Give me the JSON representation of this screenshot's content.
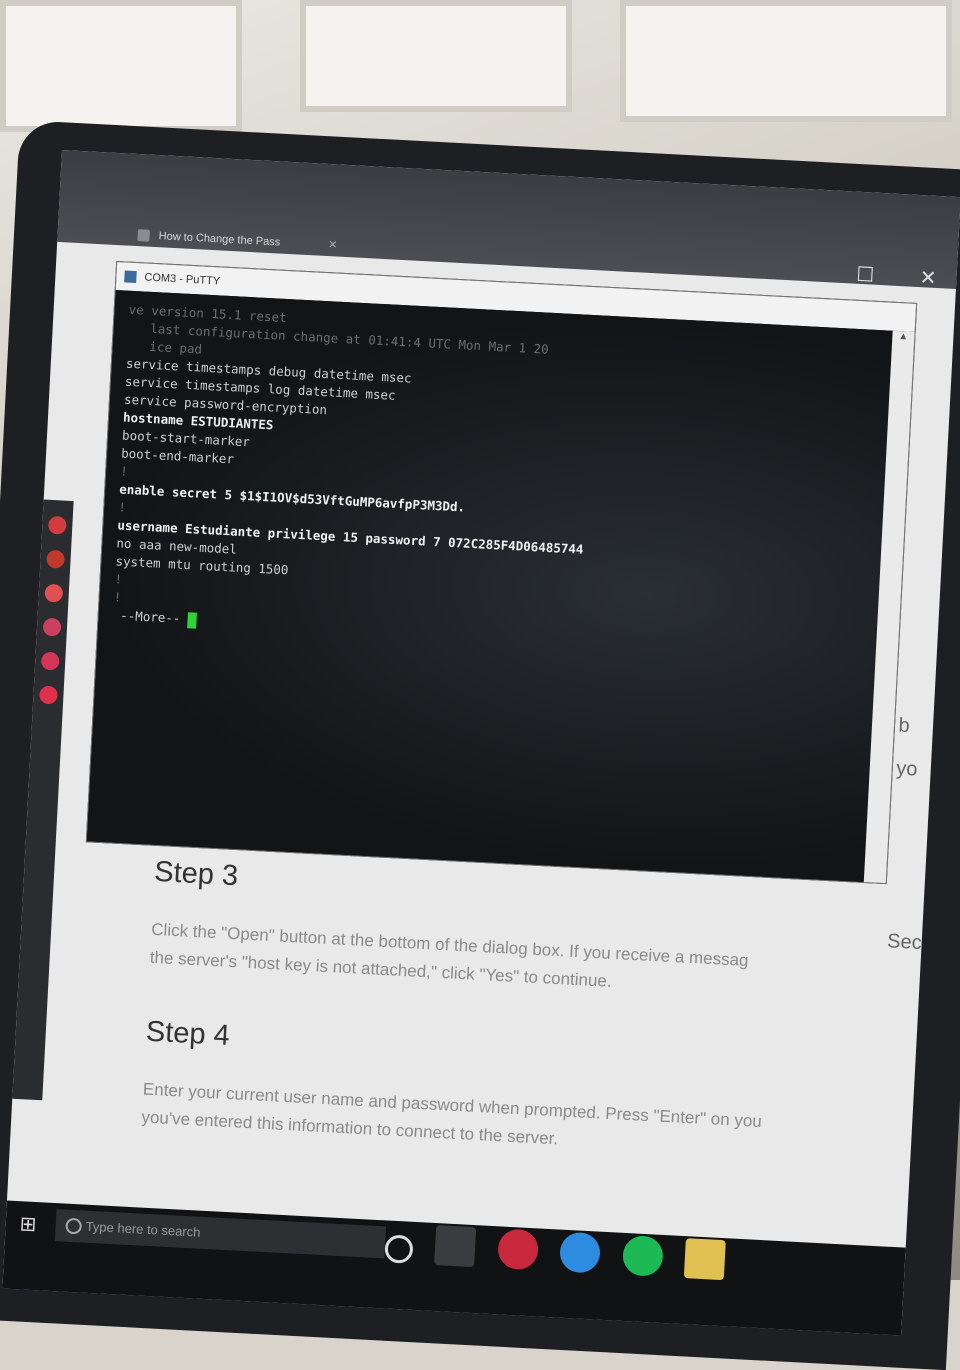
{
  "browser": {
    "tab_title": "How to Change the Pass",
    "tab_close": "✕",
    "maximize": "☐",
    "close": "✕"
  },
  "putty": {
    "title": "COM3 - PuTTY",
    "lines": [
      {
        "text": "ve version 15.1 reset",
        "style": "dim"
      },
      {
        "text": "   last configuration change at 01:41:4 UTC Mon Mar 1 20",
        "style": "dim"
      },
      {
        "text": "",
        "style": "dim"
      },
      {
        "text": "",
        "style": "dim"
      },
      {
        "text": "   ice pad",
        "style": "dim"
      },
      {
        "text": "service timestamps debug datetime msec",
        "style": "normal"
      },
      {
        "text": "service timestamps log datetime msec",
        "style": "normal"
      },
      {
        "text": "service password-encryption",
        "style": "normal"
      },
      {
        "text": "",
        "style": "dim"
      },
      {
        "text": "hostname ESTUDIANTES",
        "style": "bold"
      },
      {
        "text": "",
        "style": "dim"
      },
      {
        "text": "boot-start-marker",
        "style": "normal"
      },
      {
        "text": "boot-end-marker",
        "style": "normal"
      },
      {
        "text": "!",
        "style": "dim"
      },
      {
        "text": "",
        "style": "dim"
      },
      {
        "text": "enable secret 5 $1$I1OV$d53VftGuMP6avfpP3M3Dd.",
        "style": "bold"
      },
      {
        "text": "!",
        "style": "dim"
      },
      {
        "text": "username Estudiante privilege 15 password 7 072C285F4D06485744",
        "style": "bold"
      },
      {
        "text": "no aaa new-model",
        "style": "normal"
      },
      {
        "text": "system mtu routing 1500",
        "style": "normal"
      },
      {
        "text": "!",
        "style": "dim"
      },
      {
        "text": "!",
        "style": "dim"
      },
      {
        "text": "",
        "style": "dim"
      }
    ],
    "more_prompt": " --More-- "
  },
  "page": {
    "step3_title": "Step 3",
    "step3_text_1": "Click the \"Open\" button at the bottom of the dialog box. If you receive a messag",
    "step3_text_2": "the server's \"host key is not attached,\" click \"Yes\" to continue.",
    "step4_title": "Step 4",
    "step4_text_1": "Enter your current user name and password when prompted. Press \"Enter\" on you",
    "step4_text_2": "you've entered this information to connect to the server.",
    "right_edge_text_1": "b",
    "right_edge_text_2": "yo",
    "right_edge_text_3": "Sec"
  },
  "taskbar": {
    "search_placeholder": "Type here to search"
  }
}
